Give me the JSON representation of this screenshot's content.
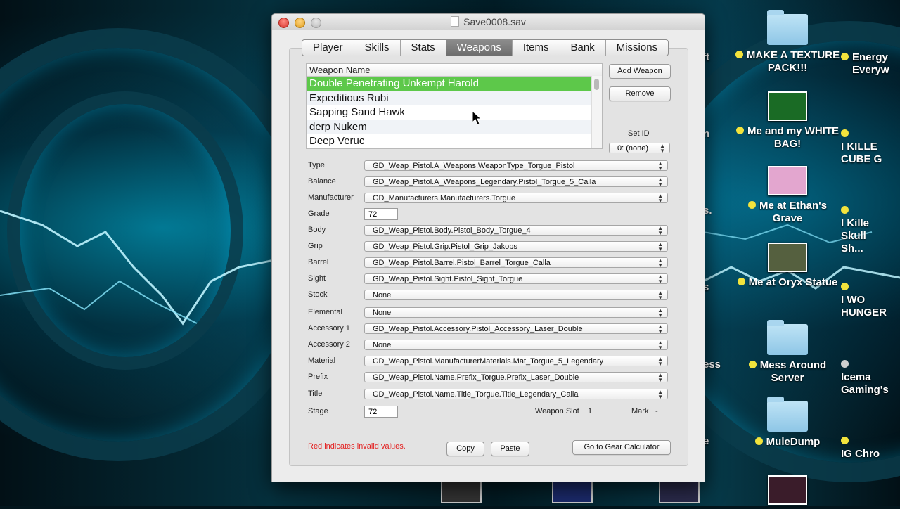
{
  "window": {
    "title": "Save0008.sav",
    "tabs": [
      "Player",
      "Skills",
      "Stats",
      "Weapons",
      "Items",
      "Bank",
      "Missions"
    ],
    "selected_tab": "Weapons"
  },
  "weapon_list": {
    "header": "Weapon Name",
    "items": [
      "Double Penetrating Unkempt Harold",
      "Expeditious Rubi",
      "Sapping Sand Hawk",
      "derp Nukem",
      "Deep Veruc"
    ],
    "selected_index": 0
  },
  "buttons": {
    "add_weapon": "Add Weapon",
    "remove": "Remove",
    "copy": "Copy",
    "paste": "Paste",
    "gear_calc": "Go to Gear Calculator"
  },
  "set_id": {
    "label": "Set ID",
    "value": "0: (none)"
  },
  "fields": [
    {
      "label": "Type",
      "value": "GD_Weap_Pistol.A_Weapons.WeaponType_Torgue_Pistol"
    },
    {
      "label": "Balance",
      "value": "GD_Weap_Pistol.A_Weapons_Legendary.Pistol_Torgue_5_Calla"
    },
    {
      "label": "Manufacturer",
      "value": "GD_Manufacturers.Manufacturers.Torgue"
    },
    {
      "label": "Grade",
      "value": "72"
    },
    {
      "label": "Body",
      "value": "GD_Weap_Pistol.Body.Pistol_Body_Torgue_4"
    },
    {
      "label": "Grip",
      "value": "GD_Weap_Pistol.Grip.Pistol_Grip_Jakobs"
    },
    {
      "label": "Barrel",
      "value": "GD_Weap_Pistol.Barrel.Pistol_Barrel_Torgue_Calla"
    },
    {
      "label": "Sight",
      "value": "GD_Weap_Pistol.Sight.Pistol_Sight_Torgue"
    },
    {
      "label": "Stock",
      "value": "None"
    },
    {
      "label": "Elemental",
      "value": "None"
    },
    {
      "label": "Accessory 1",
      "value": "GD_Weap_Pistol.Accessory.Pistol_Accessory_Laser_Double"
    },
    {
      "label": "Accessory 2",
      "value": "None"
    },
    {
      "label": "Material",
      "value": "GD_Weap_Pistol.ManufacturerMaterials.Mat_Torgue_5_Legendary"
    },
    {
      "label": "Prefix",
      "value": "GD_Weap_Pistol.Name.Prefix_Torgue.Prefix_Laser_Double"
    },
    {
      "label": "Title",
      "value": "GD_Weap_Pistol.Name.Title_Torgue.Title_Legendary_Calla"
    },
    {
      "label": "Stage",
      "value": "72"
    }
  ],
  "weapon_slot": {
    "label": "Weapon Slot",
    "value": "1"
  },
  "mark": {
    "label": "Mark",
    "value": "-"
  },
  "invalid_note": "Red indicates invalid values.",
  "desktop": {
    "right_items": [
      {
        "text": "MAKE A TEXTURE PACK!!!"
      },
      {
        "text": "Me and my WHITE BAG!"
      },
      {
        "text": "Me at Ethan's Grave"
      },
      {
        "text": "Me at Oryx Statue"
      },
      {
        "text": "Mess Around Server"
      },
      {
        "text": "MuleDump"
      }
    ],
    "edge_items": [
      {
        "text": "Energy Everyw"
      },
      {
        "text": "I KILLE CUBE G"
      },
      {
        "text": "I Kille Skull Sh..."
      },
      {
        "text": "I WO HUNGER"
      },
      {
        "text": "Icema Gaming's"
      },
      {
        "text": "IG Chro"
      }
    ],
    "left_fragments": [
      "raft",
      "n",
      "s.",
      "s",
      "ess",
      "e"
    ]
  },
  "colors": {
    "selection_green": "#5dc84a",
    "invalid_red": "#e32020"
  }
}
